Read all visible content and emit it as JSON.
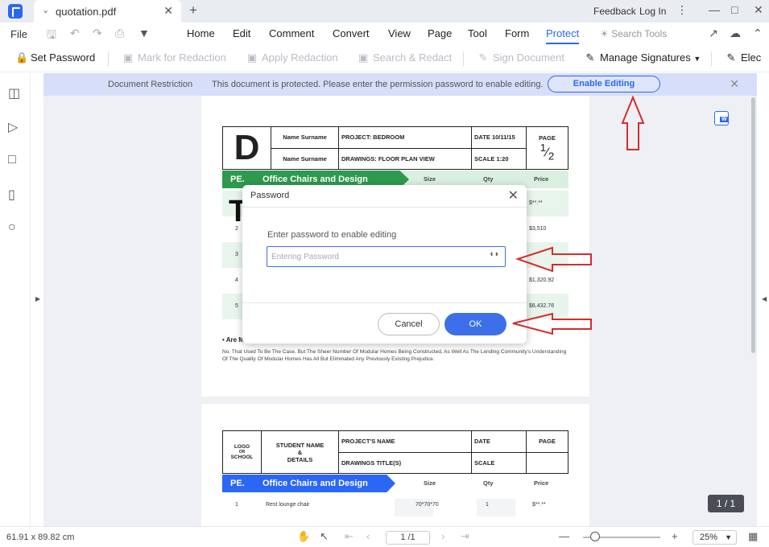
{
  "window": {
    "tab_title": "quotation.pdf",
    "feedback": "Feedback",
    "login": "Log In"
  },
  "menu": {
    "file": "File",
    "items": [
      "Home",
      "Edit",
      "Comment",
      "Convert",
      "View",
      "Page",
      "Tool",
      "Form",
      "Protect"
    ],
    "active": "Protect",
    "search_tools": "Search Tools"
  },
  "toolbar": {
    "set_password": "Set Password",
    "mark_redaction": "Mark for Redaction",
    "apply_redaction": "Apply Redaction",
    "search_redact": "Search & Redact",
    "sign_document": "Sign Document",
    "manage_signatures": "Manage Signatures",
    "electronic": "Elec"
  },
  "restriction_bar": {
    "label": "Document Restriction",
    "message": "This document is protected. Please enter the permission password to enable editing.",
    "button": "Enable Editing"
  },
  "page1": {
    "header": {
      "logo_letter": "D",
      "name1": "Name Surname",
      "name2": "Name Surname",
      "project": "PROJECT: BEDROOM",
      "drawings": "DRAWINGS: FLOOR PLAN VIEW",
      "date": "DATE 10/11/15",
      "scale": "SCALE 1:20",
      "page": "PAGE",
      "page_num": "1",
      "page_den": "2"
    },
    "band": {
      "pe": "PE.",
      "title": "Office Chairs and Design",
      "size": "Size",
      "qty": "Qty",
      "price": "Price"
    },
    "big_letter": "T",
    "rows": [
      {
        "num": "",
        "price": "$**.**"
      },
      {
        "num": "2",
        "price": "$3,510"
      },
      {
        "num": "3",
        "price": ""
      },
      {
        "num": "4",
        "price": "$1,320.92"
      },
      {
        "num": "5",
        "price": "$6,432.76"
      }
    ],
    "faq_q": "• Are M",
    "faq_a": "No. That Used To Be The Case, But The Sheer Number Of Modular Homes Being Constructed, As Well As The Lending Community's Understanding Of The Quality Of Modular Homes Has All But Eliminated Any Previously Existing Prejudice."
  },
  "page2": {
    "header": {
      "logo_l1": "LOGO",
      "logo_l2": "OR",
      "logo_l3": "SCHOOL",
      "student_l1": "STUDENT NAME",
      "student_l2": "&",
      "student_l3": "DETAILS",
      "project": "PROJECT'S NAME",
      "drawings": "DRAWINGS TITLE(S)",
      "date": "DATE",
      "scale": "SCALE",
      "page": "PAGE"
    },
    "band": {
      "pe": "PE.",
      "title": "Office Chairs and Design",
      "size": "Size",
      "qty": "Qty",
      "price": "Price"
    },
    "row": {
      "num": "1",
      "name": "Rest lounge chair",
      "size": "70*70*70",
      "qty": "1",
      "price": "$**.**"
    }
  },
  "dialog": {
    "title": "Password",
    "label": "Enter password to enable editing",
    "placeholder": "Entering Password",
    "cancel": "Cancel",
    "ok": "OK"
  },
  "status": {
    "dimensions": "61.91 x 89.82 cm",
    "page_field": "1 /1",
    "zoom": "25%",
    "page_badge": "1 / 1"
  },
  "colors": {
    "accent": "#2a67f5",
    "annotation_arrow": "#d62c2c",
    "green_band": "#2e9a4e"
  }
}
